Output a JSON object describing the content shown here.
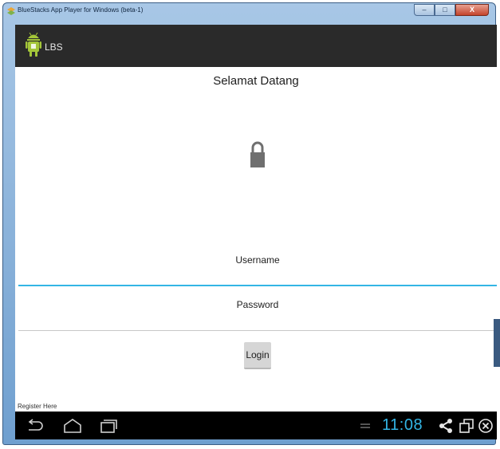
{
  "window": {
    "title": "BlueStacks App Player for Windows (beta-1)",
    "controls": {
      "minimize": "–",
      "maximize": "□",
      "close": "X"
    }
  },
  "app": {
    "title": "LBS",
    "welcome": "Selamat Datang",
    "username": {
      "value": "Username"
    },
    "password": {
      "value": "Password"
    },
    "login_label": "Login",
    "register_link": "Register Here"
  },
  "navbar": {
    "icons": [
      "back-icon",
      "home-icon",
      "recent-apps-icon",
      "keyboard-icon",
      "share-icon",
      "window-icon",
      "close-app-icon"
    ],
    "time": "11:08"
  },
  "colors": {
    "actionbar": "#2a2a2a",
    "accent": "#33b5e5",
    "navbar": "#000000"
  }
}
